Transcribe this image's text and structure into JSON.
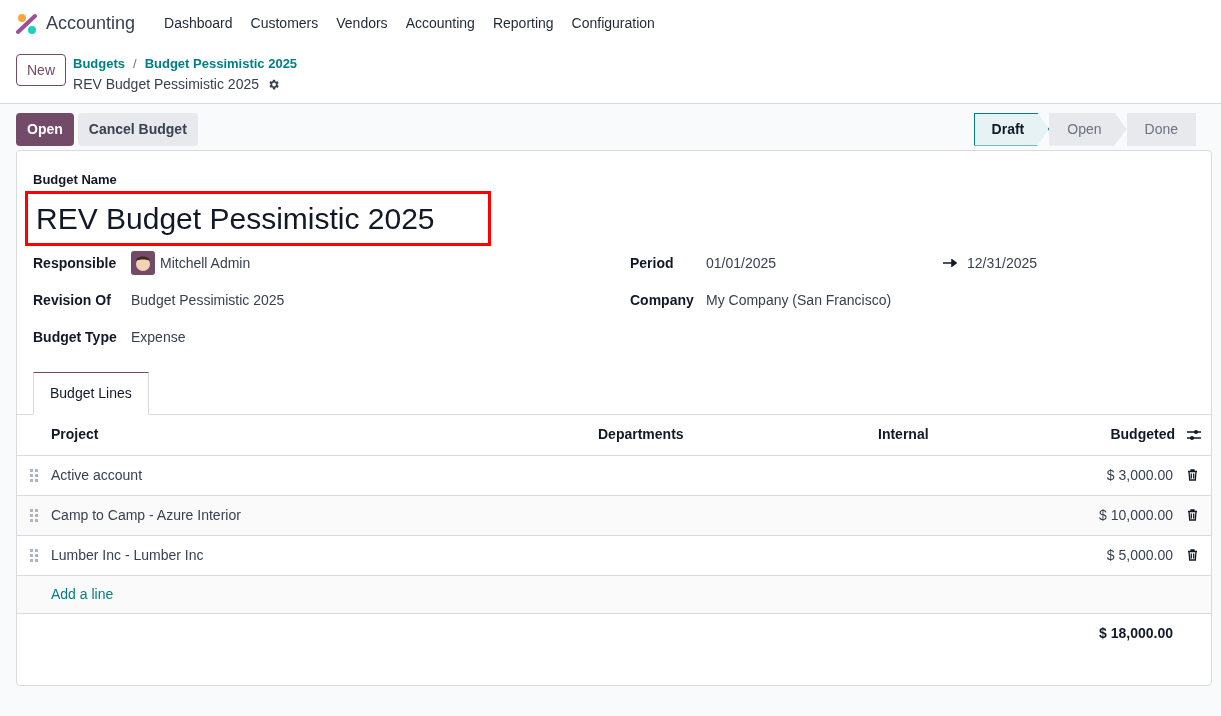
{
  "navbar": {
    "app_name": "Accounting",
    "menu": [
      "Dashboard",
      "Customers",
      "Vendors",
      "Accounting",
      "Reporting",
      "Configuration"
    ]
  },
  "control_panel": {
    "new_button": "New",
    "breadcrumbs": [
      "Budgets",
      "Budget Pessimistic 2025"
    ],
    "separator": "/",
    "current": "REV Budget Pessimistic 2025"
  },
  "actions": [
    {
      "label": "Open",
      "primary": true
    },
    {
      "label": "Cancel Budget",
      "primary": false
    }
  ],
  "statusbar": [
    {
      "label": "Draft",
      "selected": true
    },
    {
      "label": "Open",
      "selected": false
    },
    {
      "label": "Done",
      "selected": false
    }
  ],
  "form": {
    "name_label": "Budget Name",
    "name": "REV Budget Pessimistic 2025",
    "name_highlighted": true,
    "left_fields": [
      {
        "label": "Responsible",
        "value": "Mitchell Admin",
        "avatar": true
      },
      {
        "label": "Revision Of",
        "value": "Budget Pessimistic 2025",
        "avatar": false
      },
      {
        "label": "Budget Type",
        "value": "Expense",
        "avatar": false
      }
    ],
    "period": {
      "label": "Period",
      "start": "01/01/2025",
      "end": "12/31/2025"
    },
    "company": {
      "label": "Company",
      "value": "My Company (San Francisco)"
    }
  },
  "tabs": [
    {
      "label": "Budget Lines",
      "selected": true
    }
  ],
  "table": {
    "columns": [
      "Project",
      "Departments",
      "Internal",
      "Budgeted"
    ],
    "rows": [
      {
        "project": "Active account",
        "budgeted": "$ 3,000.00"
      },
      {
        "project": "Camp to Camp - Azure Interior",
        "budgeted": "$ 10,000.00"
      },
      {
        "project": "Lumber Inc - Lumber Inc",
        "budgeted": "$ 5,000.00"
      }
    ],
    "add_line": "Add a line",
    "total": "$ 18,000.00"
  }
}
